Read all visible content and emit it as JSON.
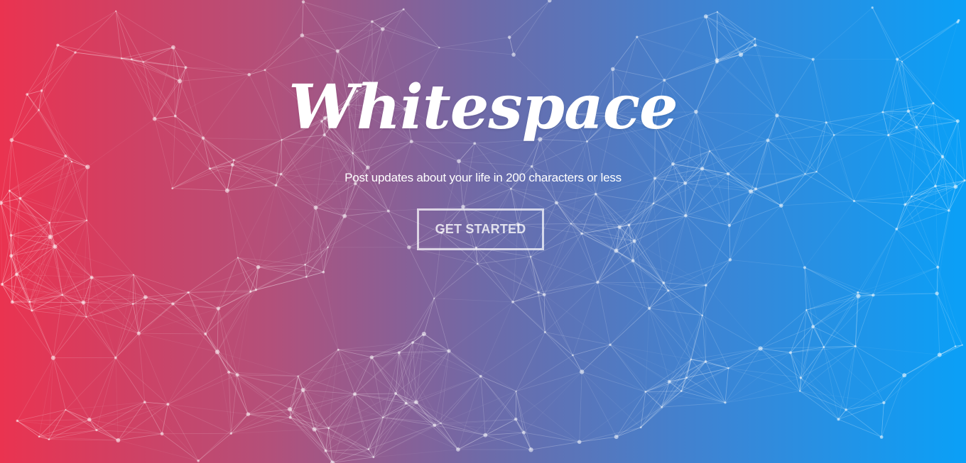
{
  "hero": {
    "title": "Whitespace",
    "tagline": "Post updates about your life in 200 characters or less",
    "cta_label": "GET STARTED"
  },
  "colors": {
    "gradient_start": "#ea3350",
    "gradient_mid": "#6e6aa8",
    "gradient_end": "#0aa0f7",
    "text": "#ffffff"
  },
  "background": {
    "style": "particle-network"
  }
}
